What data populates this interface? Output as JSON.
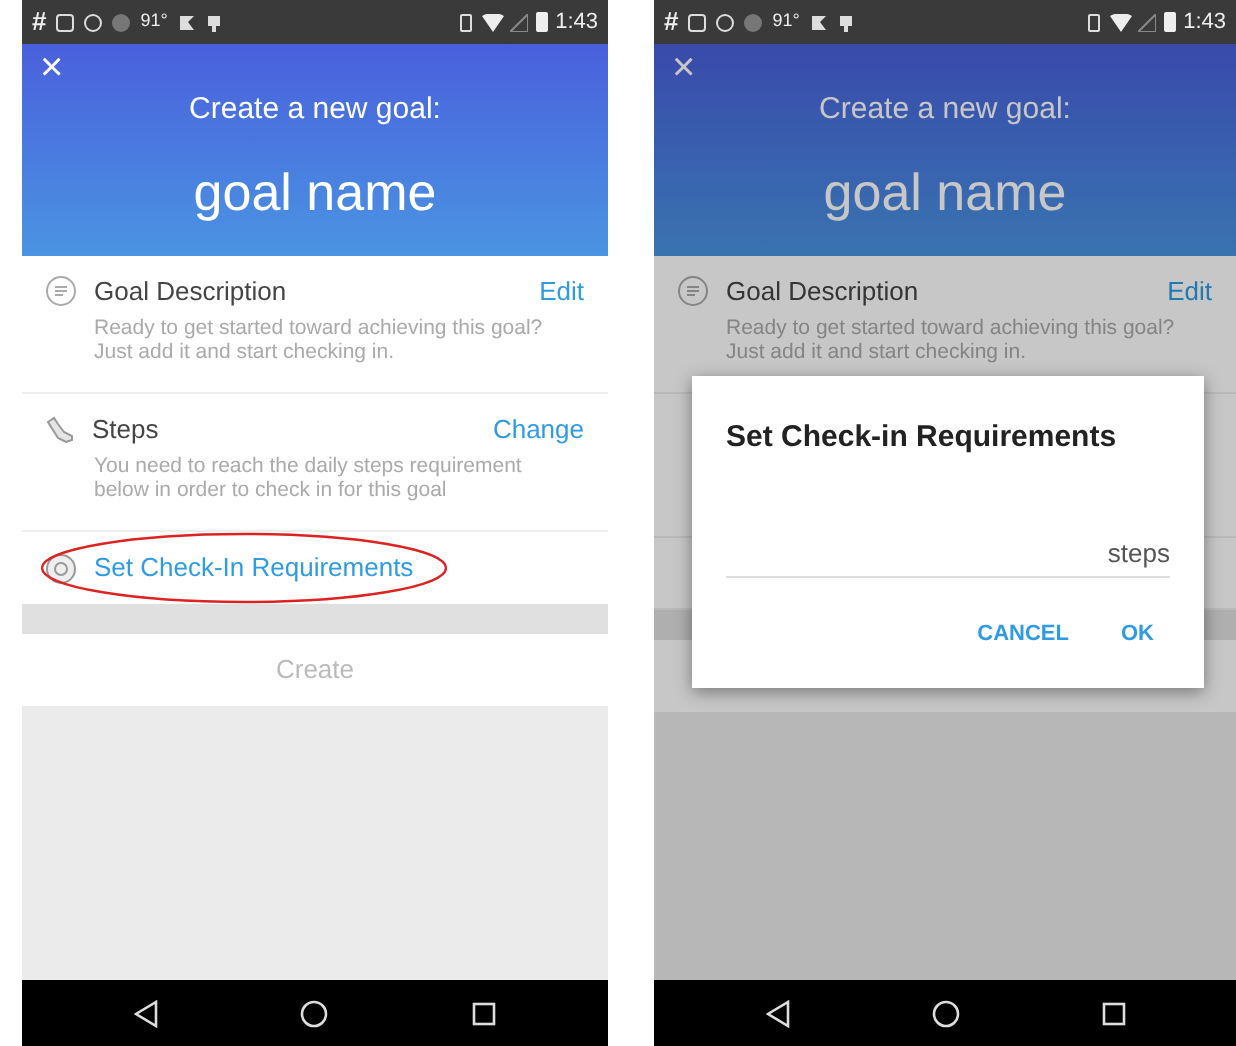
{
  "screens": [
    {
      "status_bar": {
        "hash": "#",
        "temperature": "91°",
        "time": "1:43"
      },
      "close": "×",
      "header": {
        "subtitle": "Create a new goal:",
        "title": "goal name"
      },
      "items": [
        {
          "kind": "section",
          "title": "Goal Description",
          "action": "Edit",
          "description": "Ready to get started toward achieving this goal? Just add it and start checking in."
        },
        {
          "kind": "section",
          "title": "Steps",
          "action": "Change",
          "description": "You need to reach the daily steps requirement below in order to check in for this goal"
        },
        {
          "kind": "link",
          "title": "Set Check-In Requirements",
          "circled": true
        }
      ],
      "create_button": "Create",
      "dimmed": false
    },
    {
      "status_bar": {
        "hash": "#",
        "temperature": "91°",
        "time": "1:43"
      },
      "close": "×",
      "header": {
        "subtitle": "Create a new goal:",
        "title": "goal name"
      },
      "items": [
        {
          "kind": "section",
          "title": "Goal Description",
          "action": "Edit",
          "description": "Ready to get started toward achieving this goal? Just add it and start checking in."
        },
        {
          "kind": "covered"
        },
        {
          "kind": "covered"
        }
      ],
      "dimmed": true,
      "dialog": {
        "title": "Set Check-in Requirements",
        "unit": "steps",
        "buttons": [
          "CANCEL",
          "OK"
        ]
      }
    }
  ]
}
